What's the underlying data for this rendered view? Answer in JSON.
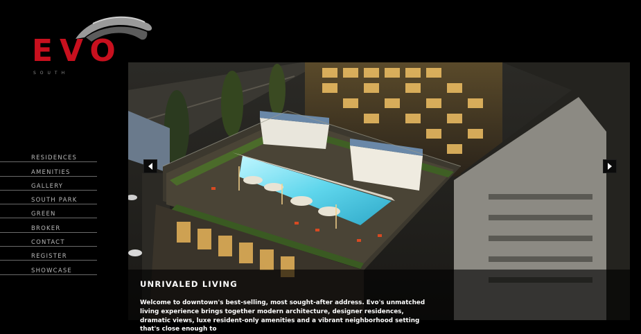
{
  "brand": {
    "name": "EVO",
    "subtitle": "SOUTH",
    "accent": "#c8101e"
  },
  "nav": {
    "items": [
      {
        "label": "RESIDENCES"
      },
      {
        "label": "AMENITIES"
      },
      {
        "label": "GALLERY"
      },
      {
        "label": "SOUTH PARK"
      },
      {
        "label": "GREEN"
      },
      {
        "label": "BROKER"
      },
      {
        "label": "CONTACT"
      },
      {
        "label": "REGISTER"
      },
      {
        "label": "SHOWCASE"
      }
    ]
  },
  "hero": {
    "prev_icon": "chevron-left-icon",
    "next_icon": "chevron-right-icon"
  },
  "caption": {
    "title": "UNRIVALED LIVING",
    "body": "Welcome to downtown's best-selling, most sought-after address. Evo's unmatched living experience brings together modern architecture, designer residences, dramatic views, luxe resident-only amenities and a vibrant neighborhood setting that's close enough to"
  }
}
